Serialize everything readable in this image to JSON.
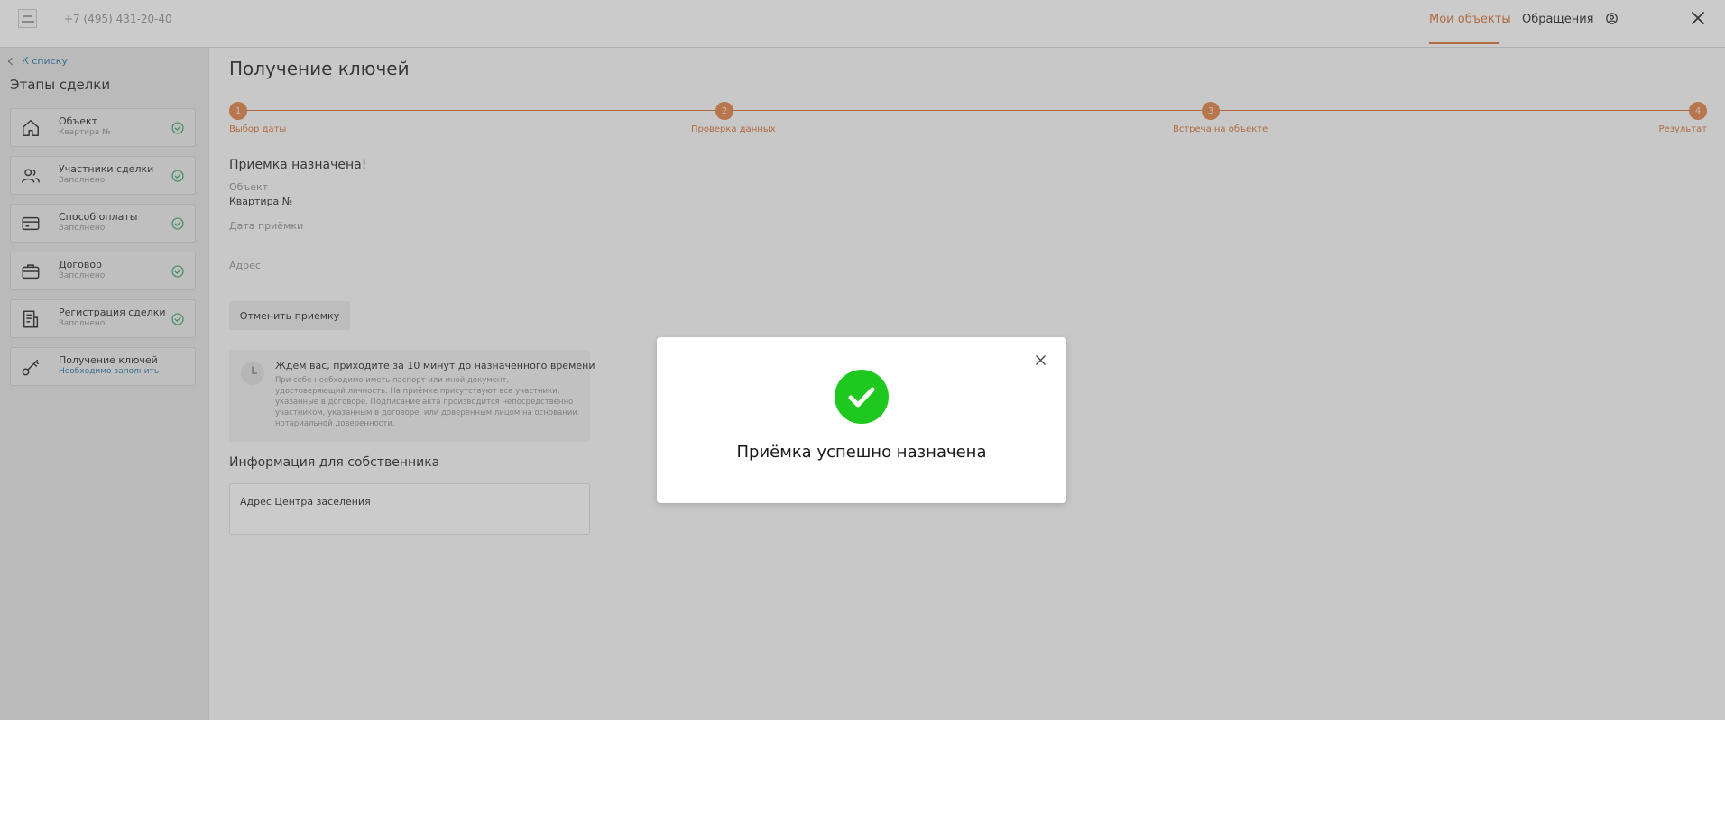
{
  "header": {
    "phone": "+7 (495) 431-20-40",
    "nav": [
      {
        "label": "Мои объекты",
        "active": true
      },
      {
        "label": "Обращения",
        "active": false
      }
    ],
    "icons": [
      "logo",
      "user-icon",
      "close-icon"
    ]
  },
  "sidebar": {
    "back_label": "К списку",
    "title": "Этапы сделки",
    "steps": [
      {
        "title": "Объект",
        "subtitle": "Квартира №",
        "icon": "home-icon",
        "done": true
      },
      {
        "title": "Участники сделки",
        "subtitle": "Заполнено",
        "icon": "users-icon",
        "done": true
      },
      {
        "title": "Способ оплаты",
        "subtitle": "Заполнено",
        "icon": "card-icon",
        "done": true
      },
      {
        "title": "Договор",
        "subtitle": "Заполнено",
        "icon": "briefcase-icon",
        "done": true
      },
      {
        "title": "Регистрация сделки",
        "subtitle": "Заполнено",
        "icon": "document-icon",
        "done": true
      },
      {
        "title": "Получение ключей",
        "subtitle": "Необходимо заполнить",
        "icon": "key-icon",
        "done": false
      }
    ]
  },
  "main": {
    "title": "Получение ключей",
    "stepper": [
      {
        "number": "1",
        "label": "Выбор даты"
      },
      {
        "number": "2",
        "label": "Проверка данных"
      },
      {
        "number": "3",
        "label": "Встреча на объекте"
      },
      {
        "number": "4",
        "label": "Результат"
      }
    ],
    "status_heading": "Приемка назначена!",
    "fields": {
      "object_label": "Объект",
      "object_value": "Квартира №",
      "date_label": "Дата приёмки",
      "address_label": "Адрес"
    },
    "cancel_button": "Отменить приемку",
    "info": {
      "title": "Ждем вас, приходите за 10 минут до назначенного времени",
      "text": "При себе необходимо иметь паспорт или иной документ, удостоверяющий личность. На приёмке присутствуют все участники, указанные в договоре. Подписание акта производится непосредственно участником, указанным в договоре, или доверенным лицом на основании нотариальной доверенности."
    },
    "owner_heading": "Информация для собственника",
    "owner_box": "Адрес Центра заселения"
  },
  "modal": {
    "title": "Приёмка успешно назначена",
    "icons": [
      "success-check-icon",
      "close-icon"
    ]
  },
  "colors": {
    "accent": "#d4692b",
    "success": "#1ec81e",
    "link": "#1e6fa0",
    "check": "#2e9e5a"
  }
}
